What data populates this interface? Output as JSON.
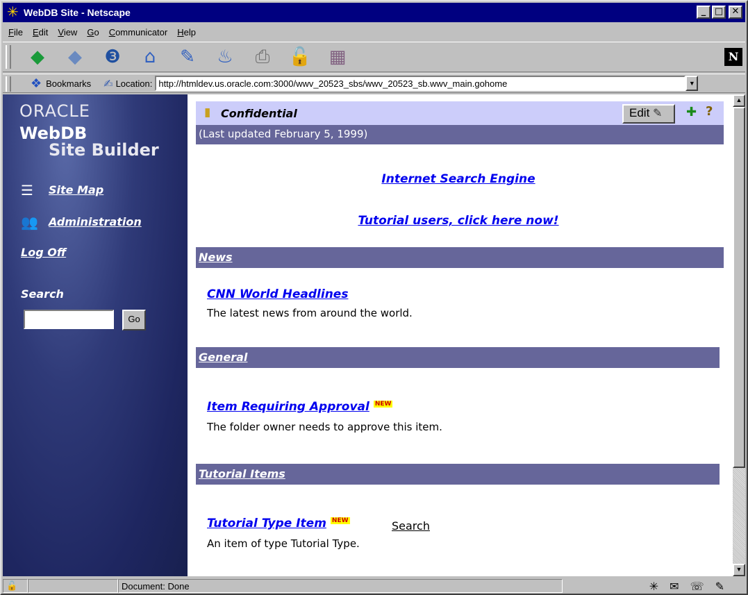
{
  "window": {
    "title": "WebDB Site - Netscape",
    "min": "_",
    "max": "□",
    "close": "✕"
  },
  "menu": [
    "File",
    "Edit",
    "View",
    "Go",
    "Communicator",
    "Help"
  ],
  "toolbar": {
    "icons": [
      "back-icon",
      "forward-icon",
      "reload-icon",
      "home-icon",
      "search-icon",
      "guide-icon",
      "print-icon",
      "security-icon",
      "stop-icon"
    ],
    "glyphs": [
      "◆",
      "◆",
      "❸",
      "⌂",
      "✎",
      "♨",
      "⎙",
      "🔓",
      "▦"
    ]
  },
  "location": {
    "bookmarks_label": "Bookmarks",
    "location_label": "Location:",
    "url": "http://htmldev.us.oracle.com:3000/wwv_20523_sbs/wwv_20523_sb.wwv_main.gohome"
  },
  "sidebar": {
    "oracle": "ORACLE",
    "webdb": "WebDB",
    "sitebuilder": "Site Builder",
    "site_map": "Site Map",
    "administration": "Administration",
    "log_off": "Log Off",
    "search_label": "Search",
    "go": "Go"
  },
  "main": {
    "folder_title": "Confidential",
    "edit_label": "Edit",
    "last_updated": "(Last updated February 5, 1999)",
    "link_search_engine": "Internet Search Engine",
    "link_tutorial_users": "Tutorial users, click here now!",
    "sections": {
      "news": "News",
      "general": "General",
      "tutorial": "Tutorial Items"
    },
    "items": {
      "cnn_title": "CNN World Headlines",
      "cnn_desc": "The latest news from around the world.",
      "approval_title": "Item Requiring Approval",
      "approval_desc": "The folder owner needs to approve this item.",
      "tutorial_title": "Tutorial Type Item",
      "tutorial_desc": "An item of type Tutorial Type.",
      "tutorial_search": "Search"
    },
    "new_badge": "NEW"
  },
  "status": {
    "text": "Document: Done"
  }
}
